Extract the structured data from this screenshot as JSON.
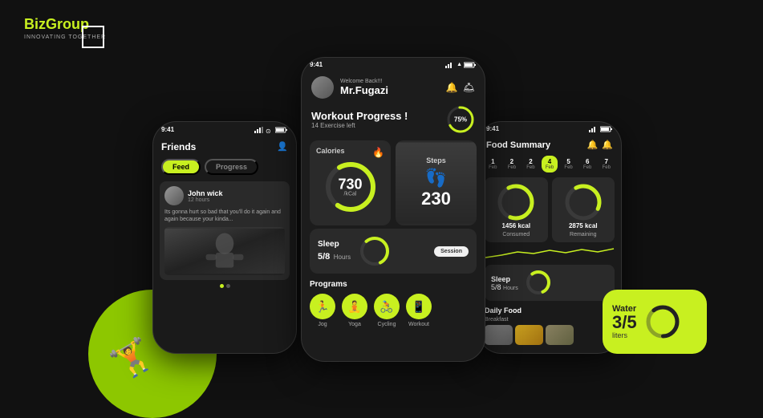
{
  "logo": {
    "name_1": "Biz",
    "name_2": "Group",
    "tagline": "INNOVATING TOGETHER"
  },
  "left_phone": {
    "status_time": "9:41",
    "title": "Friends",
    "tabs": [
      "Feed",
      "Progress"
    ],
    "active_tab": "Feed",
    "friend": {
      "name": "John wick",
      "time": "12 hours",
      "quote": "Its gonna hurt so bad that you'll do it again and again because your kinda..."
    }
  },
  "center_phone": {
    "status_time": "9:41",
    "welcome": "Welcome Back!!!",
    "username": "Mr.Fugazi",
    "workout_title": "Workout Progress !",
    "workout_sub": "14 Exercise left",
    "progress_pct": "75%",
    "calories_label": "Calories",
    "calories_value": "730",
    "calories_unit": "/kCal",
    "steps_label": "Steps",
    "steps_value": "230",
    "sleep_label": "Sleep",
    "sleep_value": "5/8",
    "sleep_unit": "Hours",
    "session_label": "Session",
    "programs_title": "Programs",
    "programs": [
      {
        "name": "Jog",
        "icon": "🏃"
      },
      {
        "name": "Yoga",
        "icon": "🧘"
      },
      {
        "name": "Cycling",
        "icon": "🚴"
      },
      {
        "name": "Workout",
        "icon": "📱"
      }
    ]
  },
  "right_phone": {
    "status_time": "9:41",
    "title": "Food Summary",
    "dates": [
      {
        "num": "1",
        "label": "Feb",
        "active": false
      },
      {
        "num": "2",
        "label": "Feb",
        "active": false
      },
      {
        "num": "2",
        "label": "Feb",
        "active": false
      },
      {
        "num": "4",
        "label": "Feb",
        "active": true
      },
      {
        "num": "5",
        "label": "Feb",
        "active": false
      },
      {
        "num": "6",
        "label": "Feb",
        "active": false
      },
      {
        "num": "7",
        "label": "Feb",
        "active": false
      }
    ],
    "consumed_label": "Consumed",
    "consumed_value": "1456 kcal",
    "remaining_label": "Remaining",
    "remaining_value": "2875 kcal",
    "sleep_label": "Sleep",
    "sleep_value": "5/8",
    "sleep_unit": "Hours",
    "daily_food_title": "Daily Food",
    "breakfast_label": "Breakfast"
  },
  "water_widget": {
    "label": "Water",
    "value": "3/5",
    "unit": "liters"
  }
}
